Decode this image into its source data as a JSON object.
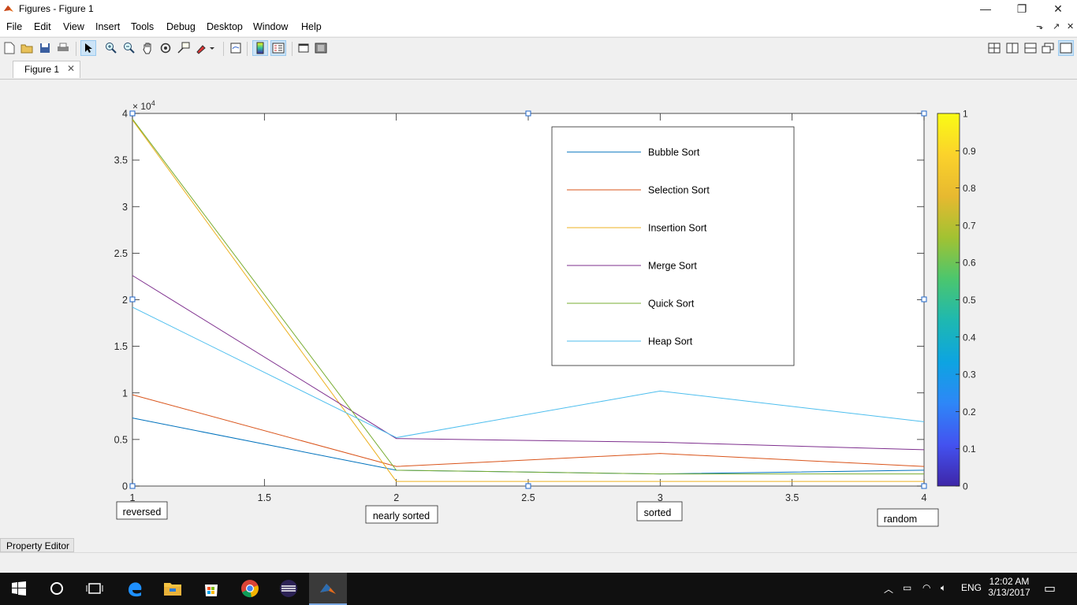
{
  "window": {
    "title": "Figures - Figure 1",
    "minimize": "—",
    "restore": "❐",
    "close": "✕"
  },
  "menu": {
    "items": [
      "File",
      "Edit",
      "View",
      "Insert",
      "Tools",
      "Debug",
      "Desktop",
      "Window",
      "Help"
    ],
    "right_glyphs": [
      "⬎",
      "↗",
      "✕"
    ]
  },
  "tabs": {
    "figure1": "Figure 1",
    "close": "✕"
  },
  "property_editor": "Property Editor",
  "taskbar": {
    "lang": "ENG",
    "time": "12:02 AM",
    "date": "3/13/2017"
  },
  "chart_data": {
    "type": "line",
    "x": [
      1,
      2,
      3,
      4
    ],
    "xlim": [
      1,
      4
    ],
    "ylim": [
      0,
      40000
    ],
    "xticks": [
      "1",
      "1.5",
      "2",
      "2.5",
      "3",
      "3.5",
      "4"
    ],
    "yticks": [
      "0",
      "0.5",
      "1",
      "1.5",
      "2",
      "2.5",
      "3",
      "3.5",
      "4"
    ],
    "y_exponent": "× 10",
    "y_exponent_power": "4",
    "grid": false,
    "legend_position": "top-right",
    "x_annotations": [
      "reversed",
      "nearly sorted",
      "sorted",
      "random"
    ],
    "colorbar": {
      "ticks": [
        "0",
        "0.1",
        "0.2",
        "0.3",
        "0.4",
        "0.5",
        "0.6",
        "0.7",
        "0.8",
        "0.9",
        "1"
      ],
      "range": [
        0,
        1
      ],
      "colormap": [
        "#3e26a8",
        "#4352f0",
        "#2e87f7",
        "#0da4e1",
        "#1eb8b1",
        "#4bc66e",
        "#a2c232",
        "#e7b930",
        "#fbd22b",
        "#f9fb15"
      ]
    },
    "series": [
      {
        "name": "Bubble Sort",
        "color": "#0072bd",
        "values": [
          7300,
          1700,
          1300,
          1700
        ]
      },
      {
        "name": "Selection Sort",
        "color": "#d95319",
        "values": [
          9800,
          2100,
          3500,
          2100
        ]
      },
      {
        "name": "Insertion Sort",
        "color": "#edb120",
        "values": [
          39300,
          500,
          500,
          500
        ]
      },
      {
        "name": "Merge Sort",
        "color": "#7e2f8e",
        "values": [
          22600,
          5100,
          4700,
          3900
        ]
      },
      {
        "name": "Quick Sort",
        "color": "#77ac30",
        "values": [
          39400,
          1700,
          1300,
          1300
        ]
      },
      {
        "name": "Heap Sort",
        "color": "#4dbeee",
        "values": [
          19200,
          5200,
          10200,
          6900
        ]
      }
    ]
  }
}
